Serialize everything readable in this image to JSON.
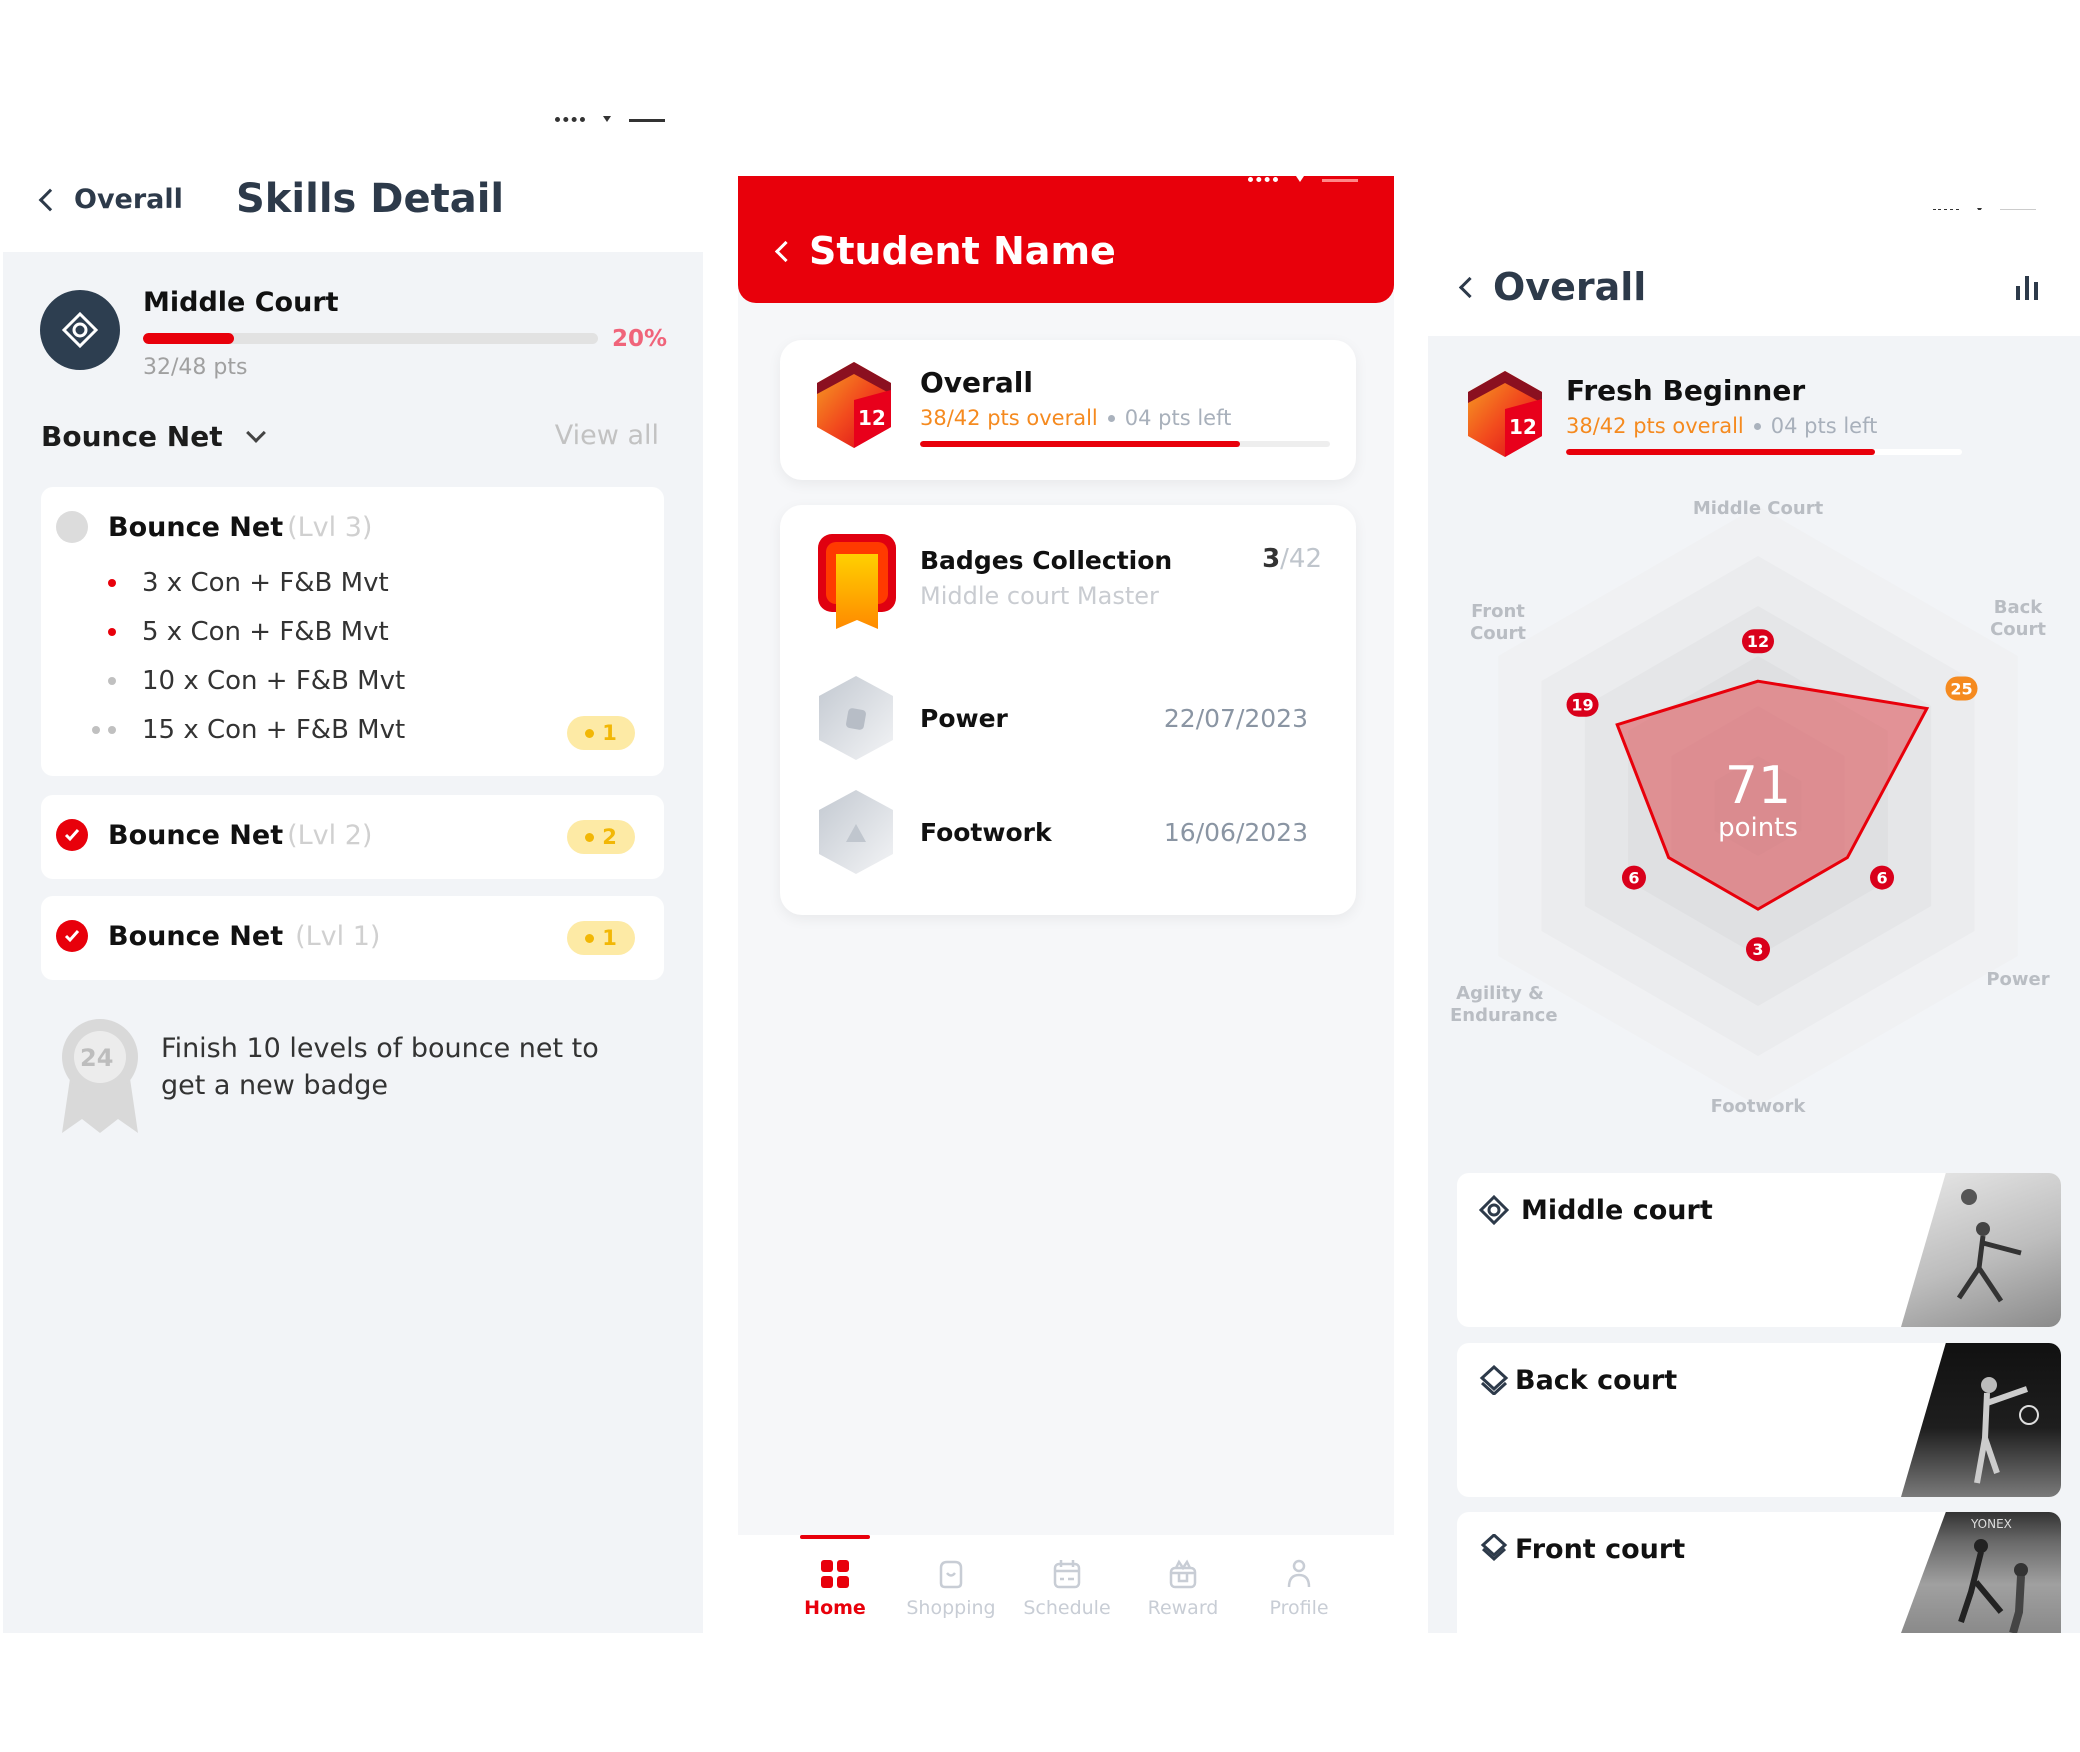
{
  "left": {
    "back_label": "Overall",
    "title": "Skills Detail",
    "skill": {
      "name": "Middle Court",
      "progress_percent": 20,
      "percent_label": "20%",
      "points": "32/48 pts"
    },
    "section": {
      "title": "Bounce Net",
      "view_all": "View all"
    },
    "levels": [
      {
        "name": "Bounce Net",
        "level": "(Lvl 3)",
        "status": "in-progress",
        "coins": null,
        "items": [
          {
            "text": "3 x Con + F&B Mvt",
            "state": "done"
          },
          {
            "text": "5 x Con + F&B Mvt",
            "state": "done"
          },
          {
            "text": "10 x Con + F&B Mvt",
            "state": "pending"
          },
          {
            "text": "15 x Con + F&B Mvt",
            "state": "pending-double",
            "coins": "1"
          }
        ]
      },
      {
        "name": "Bounce Net",
        "level": "(Lvl 2)",
        "status": "complete",
        "coins": "2"
      },
      {
        "name": "Bounce Net",
        "level": "(Lvl 1)",
        "status": "complete",
        "coins": "1"
      }
    ],
    "hint": {
      "badge_number": "24",
      "text": "Finish 10 levels of bounce net to get a new badge"
    }
  },
  "middle": {
    "back_title": "Student Name",
    "overall": {
      "title": "Overall",
      "badge_level": "12",
      "points": "38/42 pts overall",
      "left": "04 pts left",
      "progress_fraction": 0.78
    },
    "badges": {
      "title": "Badges Collection",
      "subtitle": "Middle court Master",
      "count": "3",
      "total": "/42",
      "items": [
        {
          "name": "Power",
          "date": "22/07/2023"
        },
        {
          "name": "Footwork",
          "date": "16/06/2023"
        }
      ]
    },
    "nav": [
      {
        "label": "Home",
        "icon": "home-grid-icon",
        "active": true
      },
      {
        "label": "Shopping",
        "icon": "shopping-bag-icon",
        "active": false
      },
      {
        "label": "Schedule",
        "icon": "calendar-icon",
        "active": false
      },
      {
        "label": "Reward",
        "icon": "gift-icon",
        "active": false
      },
      {
        "label": "Profile",
        "icon": "user-icon",
        "active": false
      }
    ]
  },
  "right": {
    "back_label": "Overall",
    "chart_icon": "bar-chart-icon",
    "level": {
      "title": "Fresh Beginner",
      "badge_level": "12",
      "points": "38/42 pts overall",
      "left": "04 pts left",
      "progress_fraction": 0.78
    },
    "courts": [
      {
        "title": "Middle court",
        "icon": "middle-court-icon"
      },
      {
        "title": "Back court",
        "icon": "back-court-icon"
      },
      {
        "title": "Front court",
        "icon": "front-court-icon"
      }
    ]
  },
  "chart_data": {
    "type": "radar",
    "title": "",
    "total": "71",
    "total_label": "points",
    "axes": [
      "Middle Court",
      "Back Court",
      "Power",
      "Footwork",
      "Agility & Endurance",
      "Front Court"
    ],
    "values": [
      12,
      25,
      6,
      3,
      6,
      19
    ],
    "highlight_axis": "Back Court",
    "colors": {
      "fill": "#e05a5f",
      "stroke": "#e8000b",
      "label_bg": "#d9001b",
      "highlight_bg": "#f58a1f"
    }
  }
}
